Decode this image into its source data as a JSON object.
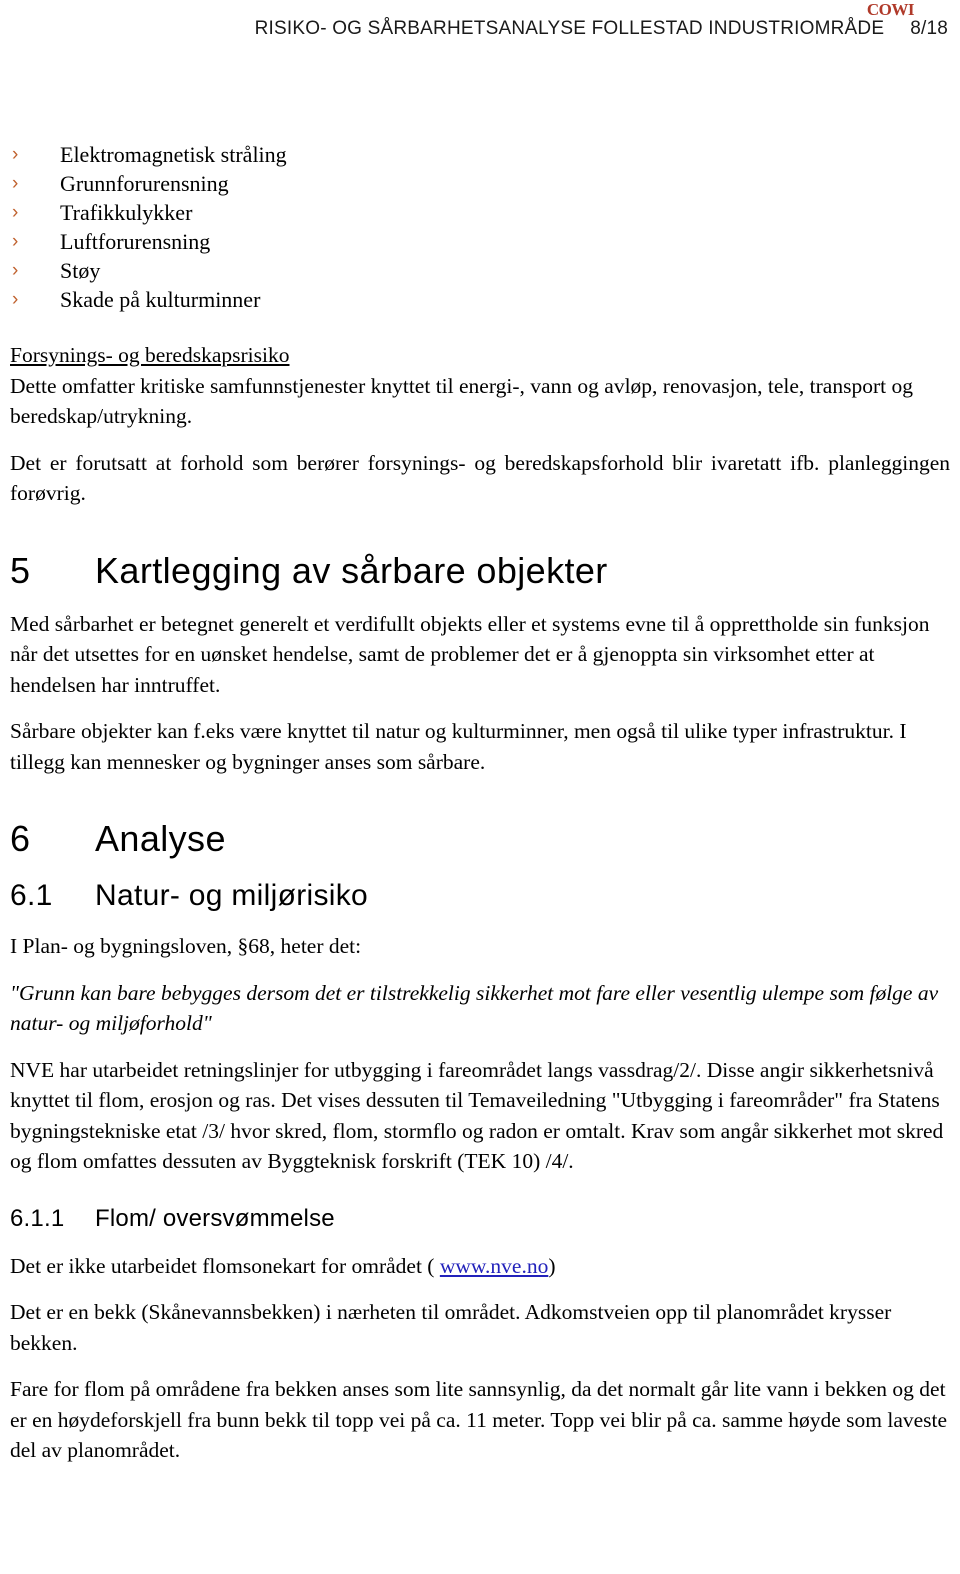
{
  "header": {
    "logo": "COWI",
    "title": "RISIKO- OG SÅRBARHETSANALYSE FOLLESTAD INDUSTRIOMRÅDE",
    "page_number": "8/18"
  },
  "colors": {
    "logo": "#b03a2a",
    "bullet_marker": "#c0622f",
    "link": "#2222bb",
    "text": "#000000"
  },
  "bullets": {
    "marker_glyph": "›",
    "items": [
      "Elektromagnetisk stråling",
      "Grunnforurensning",
      "Trafikkulykker",
      "Luftforurensning",
      "Støy",
      "Skade på kulturminner"
    ]
  },
  "sections": {
    "supply_heading": "Forsynings- og beredskapsrisiko",
    "supply_para1": "Dette omfatter kritiske samfunnstjenester knyttet til energi-, vann og avløp, renovasjon, tele, transport og beredskap/utrykning.",
    "supply_para2": "Det er forutsatt at forhold som berører forsynings- og beredskapsforhold blir ivaretatt ifb. planleggingen forøvrig.",
    "h5_num": "5",
    "h5_title": "Kartlegging av sårbare objekter",
    "h5_para1": "Med sårbarhet er betegnet generelt et verdifullt objekts eller et systems evne til å opprettholde sin funksjon når det utsettes for en uønsket hendelse, samt de problemer det er å gjenoppta sin virksomhet etter at hendelsen har inntruffet.",
    "h5_para2": "Sårbare objekter kan f.eks være knyttet til natur og kulturminner, men også til ulike typer infrastruktur. I tillegg kan mennesker og bygninger anses som sårbare.",
    "h6_num": "6",
    "h6_title": "Analyse",
    "h61_num": "6.1",
    "h61_title": "Natur- og miljørisiko",
    "h61_para1": "I Plan- og bygningsloven, §68, heter det:",
    "h61_quote": "\"Grunn kan bare bebygges dersom det er tilstrekkelig sikkerhet mot fare eller vesentlig ulempe som følge av natur- og miljøforhold\"",
    "h61_para2": "NVE har utarbeidet retningslinjer for utbygging i fareområdet langs vassdrag/2/. Disse angir sikkerhetsnivå knyttet til flom, erosjon og ras. Det vises dessuten til Temaveiledning \"Utbygging i fareområder\" fra Statens bygningstekniske etat /3/ hvor skred, flom, stormflo og radon er omtalt. Krav som angår sikkerhet mot skred og flom omfattes dessuten av Byggteknisk forskrift (TEK 10) /4/.",
    "h611_num": "6.1.1",
    "h611_title": "Flom/ oversvømmelse",
    "h611_para1_before": "Det er ikke utarbeidet flomsonekart for området ( ",
    "h611_link_text": "www.nve.no",
    "h611_para1_after": ")",
    "h611_para2": "Det er en bekk (Skånevannsbekken) i nærheten til området. Adkomstveien opp til planområdet krysser bekken.",
    "h611_para3": "Fare for flom på områdene fra bekken anses som lite sannsynlig, da det normalt går lite vann i bekken og det er en høydeforskjell fra bunn bekk til topp vei på ca. 11 meter. Topp vei blir på ca. samme høyde som laveste del av planområdet."
  }
}
